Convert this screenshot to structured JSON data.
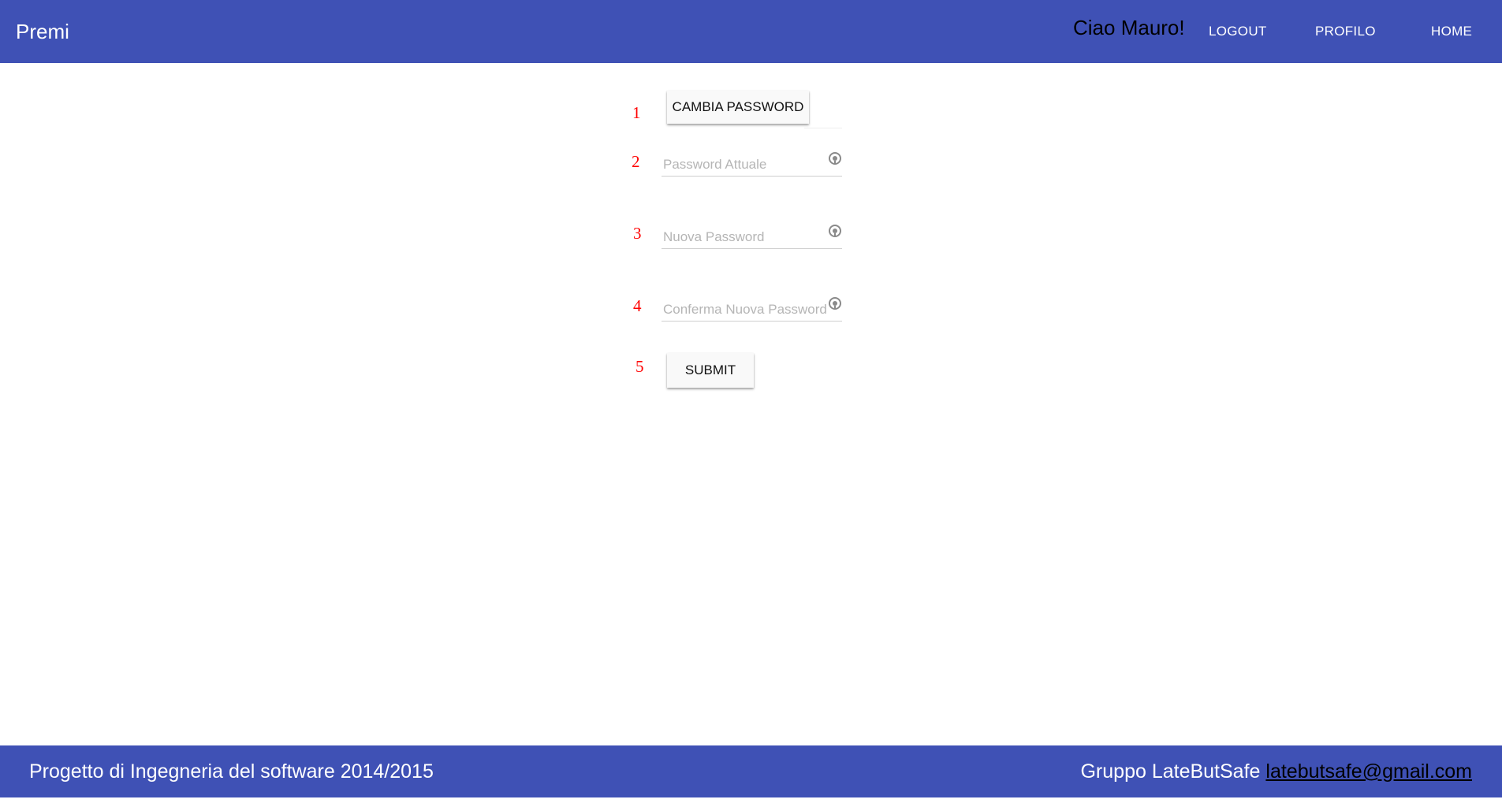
{
  "header": {
    "brand": "Premi",
    "greeting": "Ciao Mauro!",
    "nav": {
      "logout": "LOGOUT",
      "profilo": "PROFILO",
      "home": "HOME"
    }
  },
  "form": {
    "step_numbers": [
      "1",
      "2",
      "3",
      "4",
      "5"
    ],
    "cambia_password_label": "CAMBIA PASSWORD",
    "fields": [
      {
        "placeholder": "Password Attuale",
        "value": "",
        "icon": "eye-icon"
      },
      {
        "placeholder": "Nuova Password",
        "value": "",
        "icon": "eye-icon"
      },
      {
        "placeholder": "Conferma Nuova Password",
        "value": "",
        "icon": "eye-icon"
      }
    ],
    "submit_label": "SUBMIT"
  },
  "footer": {
    "left_text": "Progetto di Ingegneria del software 2014/2015",
    "group_text": "Gruppo LateButSafe",
    "email": "latebutsafe@gmail.com"
  },
  "colors": {
    "primary": "#3f51b5",
    "step_number": "#ff0000",
    "background": "#ffffff"
  }
}
